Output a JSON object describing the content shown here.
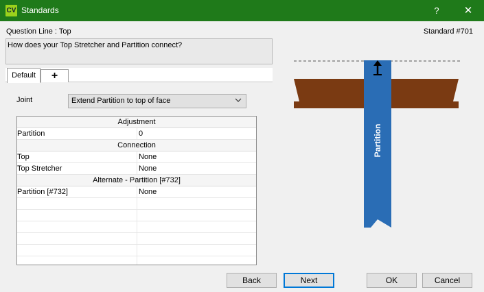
{
  "window": {
    "app_icon": "CV",
    "title": "Standards",
    "help": "?",
    "close": "✕"
  },
  "question": {
    "line_label": "Question Line : Top",
    "standard_number": "Standard #701",
    "text": "How does your Top Stretcher and Partition connect?"
  },
  "tabs": [
    {
      "label": "Default"
    },
    {
      "label": "+"
    }
  ],
  "joint": {
    "label": "Joint",
    "selected": "Extend Partition to top of face"
  },
  "grid": {
    "sections": [
      {
        "title": "Adjustment",
        "rows": [
          {
            "name": "Partition",
            "value": "0"
          }
        ]
      },
      {
        "title": "Connection",
        "rows": [
          {
            "name": "Top",
            "value": "None"
          },
          {
            "name": "Top Stretcher",
            "value": "None"
          }
        ]
      },
      {
        "title": "Alternate - Partition [#732]",
        "rows": [
          {
            "name": "Partition [#732]",
            "value": "None"
          }
        ]
      }
    ]
  },
  "diagram": {
    "partition_label": "Partition",
    "colors": {
      "partition": "#2a6db5",
      "stretcher": "#7a3a12"
    }
  },
  "buttons": {
    "back": "Back",
    "next": "Next",
    "ok": "OK",
    "cancel": "Cancel"
  }
}
